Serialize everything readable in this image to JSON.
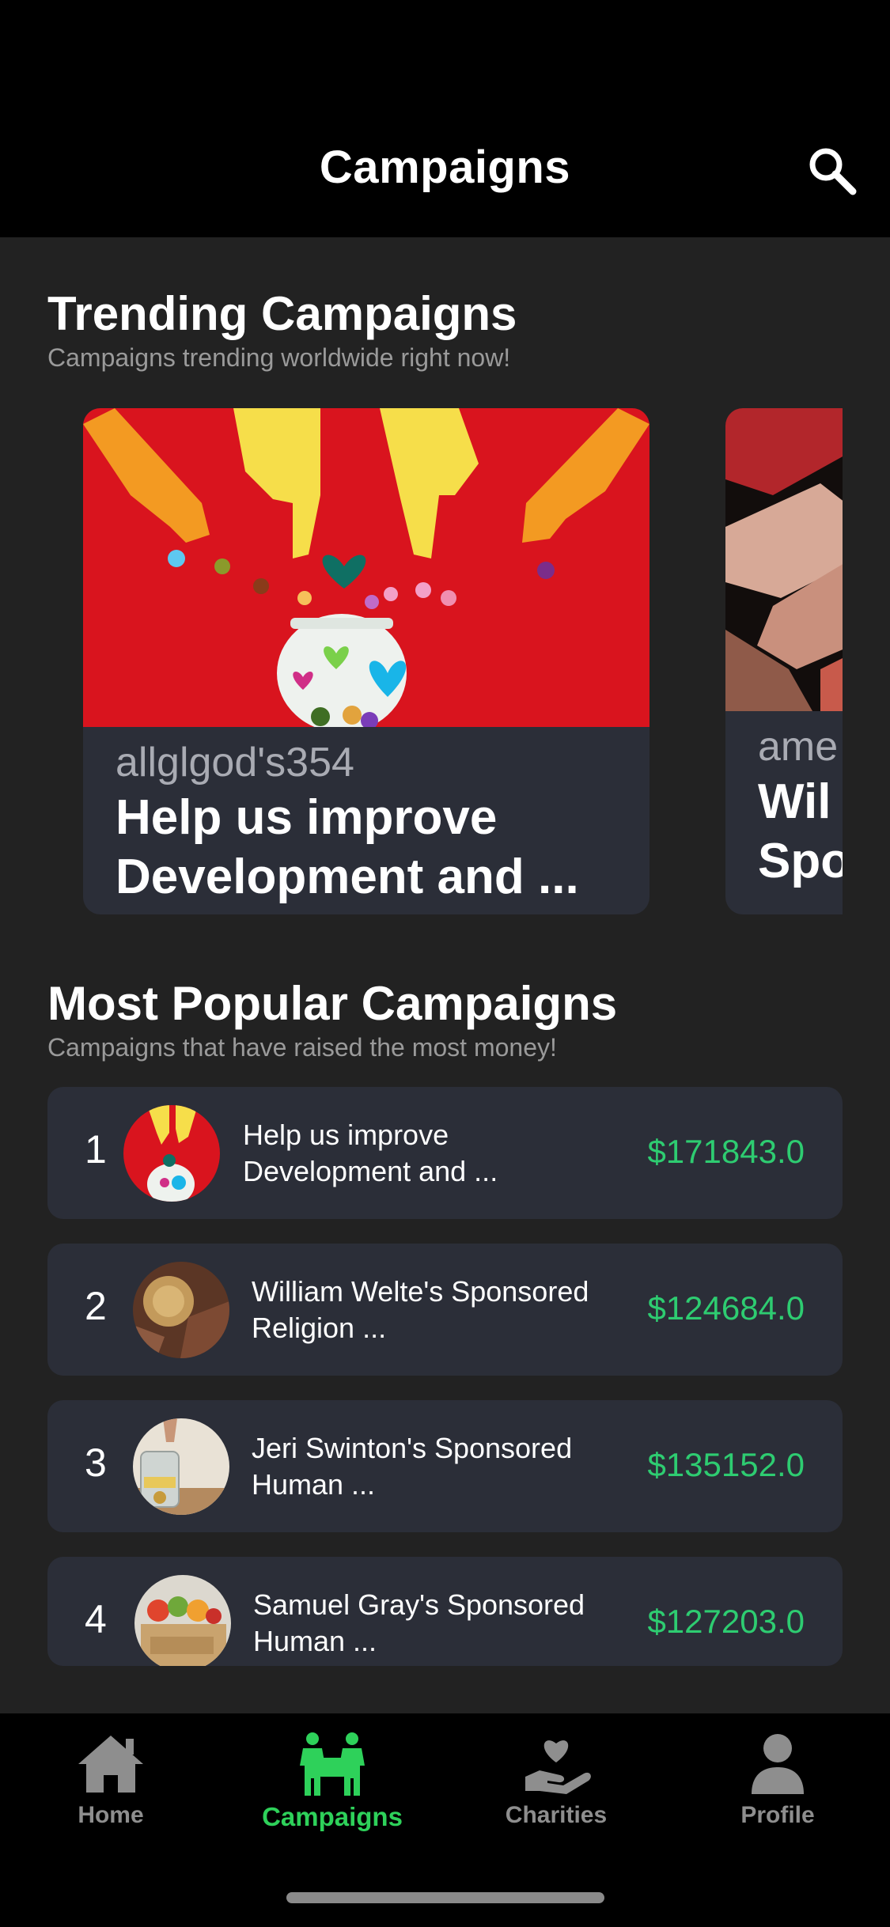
{
  "header": {
    "title": "Campaigns",
    "search_icon": "search-icon"
  },
  "trending": {
    "title": "Trending Campaigns",
    "subtitle": "Campaigns trending worldwide right now!",
    "cards": [
      {
        "user": "allglgod's354",
        "title": "Help us improve Development and ..."
      },
      {
        "user": "ame",
        "title": "Wil Spo"
      }
    ]
  },
  "popular": {
    "title": "Most Popular Campaigns",
    "subtitle": "Campaigns that have raised the most money!",
    "rows": [
      {
        "rank": "1",
        "title": "Help us improve Development and ...",
        "amount": "$171843.0"
      },
      {
        "rank": "2",
        "title": "William Welte's Sponsored Religion ...",
        "amount": "$124684.0"
      },
      {
        "rank": "3",
        "title": "Jeri Swinton's Sponsored Human ...",
        "amount": "$135152.0"
      },
      {
        "rank": "4",
        "title": "Samuel Gray's Sponsored Human ...",
        "amount": "$127203.0"
      }
    ]
  },
  "tabs": [
    {
      "label": "Home",
      "icon": "home-icon"
    },
    {
      "label": "Campaigns",
      "icon": "campaigns-icon",
      "active": true
    },
    {
      "label": "Charities",
      "icon": "charities-icon"
    },
    {
      "label": "Profile",
      "icon": "profile-icon"
    }
  ],
  "colors": {
    "accent": "#2ED15A",
    "amount": "#2ECC71",
    "card": "#2B2E38",
    "background": "#222222"
  }
}
